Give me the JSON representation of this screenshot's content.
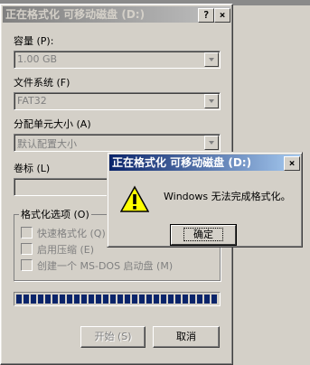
{
  "main_window": {
    "title": "正在格式化 可移动磁盘 (D:)",
    "help_glyph": "?",
    "close_glyph": "×",
    "capacity_label": "容量 (P):",
    "capacity_value": "1.00 GB",
    "filesystem_label": "文件系统 (F)",
    "filesystem_value": "FAT32",
    "allocation_label": "分配单元大小 (A)",
    "allocation_value": "默认配置大小",
    "volume_label": "卷标 (L)",
    "volume_value": "",
    "format_options_label": "格式化选项 (O)",
    "options": [
      {
        "label": "快速格式化 (Q)",
        "checked": false
      },
      {
        "label": "启用压缩 (E)",
        "checked": false
      },
      {
        "label": "创建一个 MS-DOS 启动盘 (M)",
        "checked": false
      }
    ],
    "progress": 1.0,
    "start_label": "开始 (S)",
    "cancel_label": "取消"
  },
  "dialog": {
    "title": "正在格式化 可移动磁盘 (D:)",
    "close_glyph": "×",
    "message": "Windows 无法完成格式化。",
    "ok_label": "确定"
  },
  "icons": {
    "dialog": "warning-icon"
  },
  "colors": {
    "title_active": "#0a246a",
    "title_inactive": "#808080",
    "progress": "#0a246a"
  }
}
